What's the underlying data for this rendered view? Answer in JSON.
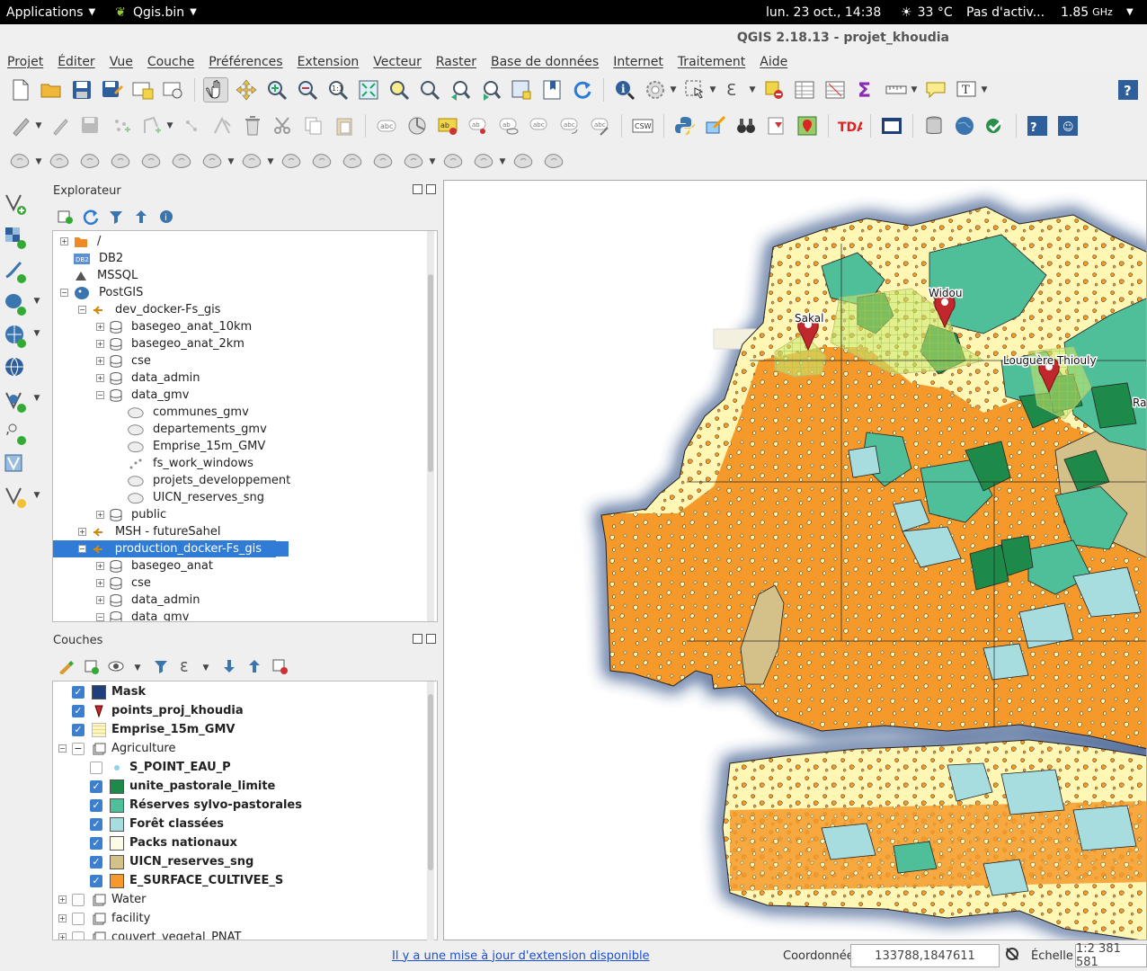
{
  "topbar": {
    "applications": "Applications",
    "app": "Qgis.bin",
    "datetime": "lun. 23 oct., 14:38",
    "temperature": "33 °C",
    "activity": "Pas d'activ...",
    "cpu": "1.85",
    "cpu_unit": "GHz"
  },
  "window": {
    "title": "QGIS 2.18.13 - projet_khoudia"
  },
  "menu": [
    "Projet",
    "Éditer",
    "Vue",
    "Couche",
    "Préférences",
    "Extension",
    "Vecteur",
    "Raster",
    "Base de données",
    "Internet",
    "Traitement",
    "Aide"
  ],
  "explorer": {
    "title": "Explorateur",
    "items": [
      {
        "label": "/",
        "depth": 0,
        "exp": "+",
        "icon": "folder-icon"
      },
      {
        "label": "DB2",
        "depth": 0,
        "exp": "",
        "icon": "db2-icon"
      },
      {
        "label": "MSSQL",
        "depth": 0,
        "exp": "",
        "icon": "mssql-icon"
      },
      {
        "label": "PostGIS",
        "depth": 0,
        "exp": "−",
        "icon": "postgis-icon"
      },
      {
        "label": "dev_docker-Fs_gis",
        "depth": 1,
        "exp": "−",
        "icon": "connection-icon"
      },
      {
        "label": "basegeo_anat_10km",
        "depth": 2,
        "exp": "+",
        "icon": "schema-icon"
      },
      {
        "label": "basegeo_anat_2km",
        "depth": 2,
        "exp": "+",
        "icon": "schema-icon"
      },
      {
        "label": "cse",
        "depth": 2,
        "exp": "+",
        "icon": "schema-icon"
      },
      {
        "label": "data_admin",
        "depth": 2,
        "exp": "+",
        "icon": "schema-icon"
      },
      {
        "label": "data_gmv",
        "depth": 2,
        "exp": "−",
        "icon": "schema-icon"
      },
      {
        "label": "communes_gmv",
        "depth": 3,
        "exp": "",
        "icon": "polygon-layer-icon"
      },
      {
        "label": "departements_gmv",
        "depth": 3,
        "exp": "",
        "icon": "polygon-layer-icon"
      },
      {
        "label": "Emprise_15m_GMV",
        "depth": 3,
        "exp": "",
        "icon": "polygon-layer-icon"
      },
      {
        "label": "fs_work_windows",
        "depth": 3,
        "exp": "",
        "icon": "point-layer-icon"
      },
      {
        "label": "projets_developpement",
        "depth": 3,
        "exp": "",
        "icon": "polygon-layer-icon"
      },
      {
        "label": "UICN_reserves_sng",
        "depth": 3,
        "exp": "",
        "icon": "polygon-layer-icon"
      },
      {
        "label": "public",
        "depth": 2,
        "exp": "+",
        "icon": "schema-icon"
      },
      {
        "label": "MSH - futureSahel",
        "depth": 1,
        "exp": "+",
        "icon": "connection-icon"
      },
      {
        "label": "production_docker-Fs_gis",
        "depth": 1,
        "exp": "−",
        "icon": "connection-icon",
        "selected": true
      },
      {
        "label": "basegeo_anat",
        "depth": 2,
        "exp": "+",
        "icon": "schema-icon"
      },
      {
        "label": "cse",
        "depth": 2,
        "exp": "+",
        "icon": "schema-icon"
      },
      {
        "label": "data_admin",
        "depth": 2,
        "exp": "+",
        "icon": "schema-icon"
      },
      {
        "label": "data_gmv",
        "depth": 2,
        "exp": "−",
        "icon": "schema-icon"
      }
    ]
  },
  "layers": {
    "title": "Couches",
    "items": [
      {
        "label": "Mask",
        "depth": 0,
        "exp": "",
        "checked": true,
        "symbol": "#1f3f7a",
        "kind": "fill"
      },
      {
        "label": "points_proj_khoudia",
        "depth": 0,
        "exp": "",
        "checked": true,
        "symbol": "#c0282d",
        "kind": "pin"
      },
      {
        "label": "Emprise_15m_GMV",
        "depth": 0,
        "exp": "",
        "checked": true,
        "symbol": "#f5e27a",
        "kind": "grid"
      },
      {
        "label": "Agriculture",
        "depth": 0,
        "exp": "−",
        "checked": null,
        "symbol": "",
        "kind": "group",
        "partial": true
      },
      {
        "label": "S_POINT_EAU_P",
        "depth": 1,
        "exp": "",
        "checked": false,
        "symbol": "#8fd3e8",
        "kind": "dot"
      },
      {
        "label": "unite_pastorale_limite",
        "depth": 1,
        "exp": "",
        "checked": true,
        "symbol": "#1e8a4a",
        "kind": "fill"
      },
      {
        "label": "Réserves sylvo-pastorales",
        "depth": 1,
        "exp": "",
        "checked": true,
        "symbol": "#4fbf9a",
        "kind": "fill"
      },
      {
        "label": "Forêt classées",
        "depth": 1,
        "exp": "",
        "checked": true,
        "symbol": "#a8dde0",
        "kind": "fill"
      },
      {
        "label": "Packs nationaux",
        "depth": 1,
        "exp": "",
        "checked": true,
        "symbol": "#fbfbe8",
        "kind": "fill"
      },
      {
        "label": "UICN_reserves_sng",
        "depth": 1,
        "exp": "",
        "checked": true,
        "symbol": "#d4c089",
        "kind": "fill"
      },
      {
        "label": "E_SURFACE_CULTIVEE_S",
        "depth": 1,
        "exp": "",
        "checked": true,
        "symbol": "#f59a2a",
        "kind": "fill"
      },
      {
        "label": "Water",
        "depth": 0,
        "exp": "+",
        "checked": false,
        "symbol": "",
        "kind": "group"
      },
      {
        "label": "facility",
        "depth": 0,
        "exp": "+",
        "checked": false,
        "symbol": "",
        "kind": "group"
      },
      {
        "label": "couvert_vegetal_PNAT",
        "depth": 0,
        "exp": "+",
        "checked": false,
        "symbol": "",
        "kind": "group"
      }
    ]
  },
  "map": {
    "labels": [
      "Sakal",
      "Widou",
      "Louguère Thiouly",
      "Ra"
    ],
    "colors": {
      "sea": "#ffffff",
      "land": "#fff7b3",
      "cultivated": "#f59a2a",
      "reserve": "#4fbf9a",
      "pastoral": "#1e8a4a",
      "forest": "#a8dde0",
      "uicn": "#d4c089",
      "mask": "#1f3f7a",
      "pin": "#c0282d"
    }
  },
  "status": {
    "update_link": "Il y a une mise à jour d'extension disponible",
    "coord_label": "Coordonnée",
    "coord_value": "133788,1847611",
    "scale_label": "Échelle",
    "scale_value": "1:2 381 581"
  }
}
